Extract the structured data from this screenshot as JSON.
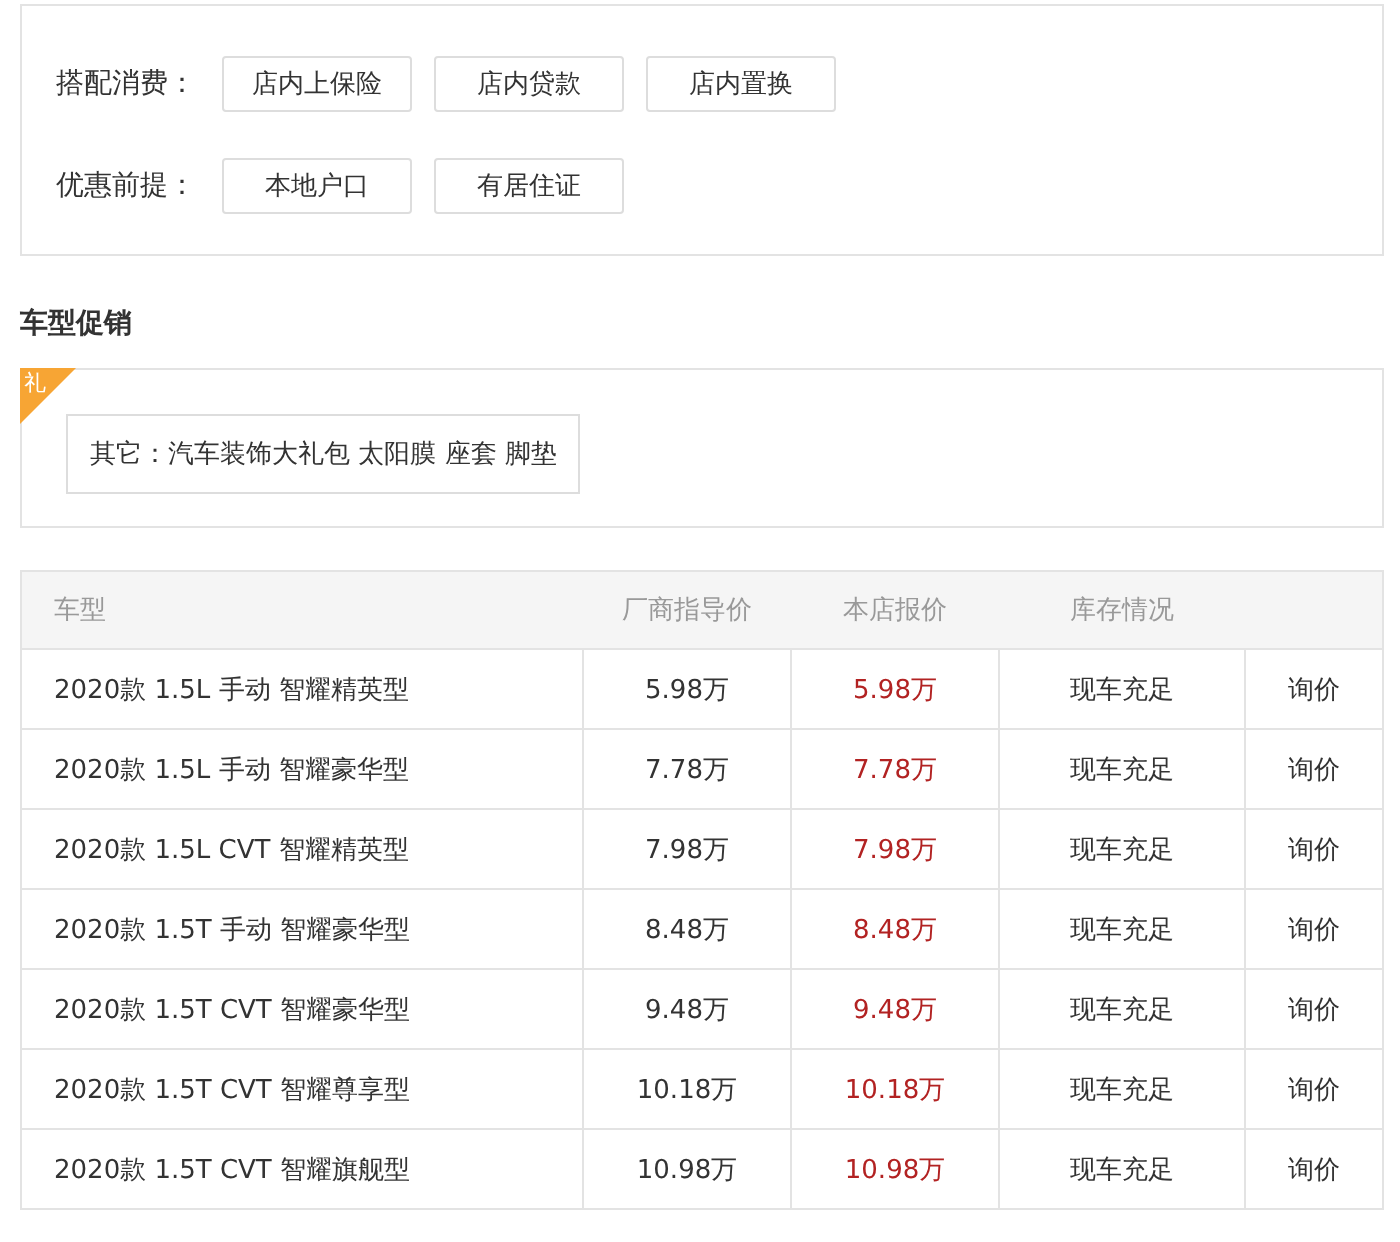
{
  "options": [
    {
      "label": "搭配消费：",
      "tags": [
        "店内上保险",
        "店内贷款",
        "店内置换"
      ]
    },
    {
      "label": "优惠前提：",
      "tags": [
        "本地户口",
        "有居住证"
      ]
    }
  ],
  "promo_section": {
    "title": "车型促销",
    "badge": "礼",
    "promo_text": "其它：汽车装饰大礼包 太阳膜 座套 脚垫"
  },
  "table": {
    "columns": [
      "车型",
      "厂商指导价",
      "本店报价",
      "库存情况"
    ],
    "rows": [
      {
        "model": "2020款 1.5L 手动 智耀精英型",
        "msrp": "5.98万",
        "price": "5.98万",
        "stock": "现车充足",
        "action": "询价"
      },
      {
        "model": "2020款 1.5L 手动 智耀豪华型",
        "msrp": "7.78万",
        "price": "7.78万",
        "stock": "现车充足",
        "action": "询价"
      },
      {
        "model": "2020款 1.5L CVT 智耀精英型",
        "msrp": "7.98万",
        "price": "7.98万",
        "stock": "现车充足",
        "action": "询价"
      },
      {
        "model": "2020款 1.5T 手动 智耀豪华型",
        "msrp": "8.48万",
        "price": "8.48万",
        "stock": "现车充足",
        "action": "询价"
      },
      {
        "model": "2020款 1.5T CVT 智耀豪华型",
        "msrp": "9.48万",
        "price": "9.48万",
        "stock": "现车充足",
        "action": "询价"
      },
      {
        "model": "2020款 1.5T CVT 智耀尊享型",
        "msrp": "10.18万",
        "price": "10.18万",
        "stock": "现车充足",
        "action": "询价"
      },
      {
        "model": "2020款 1.5T CVT 智耀旗舰型",
        "msrp": "10.98万",
        "price": "10.98万",
        "stock": "现车充足",
        "action": "询价"
      }
    ]
  }
}
